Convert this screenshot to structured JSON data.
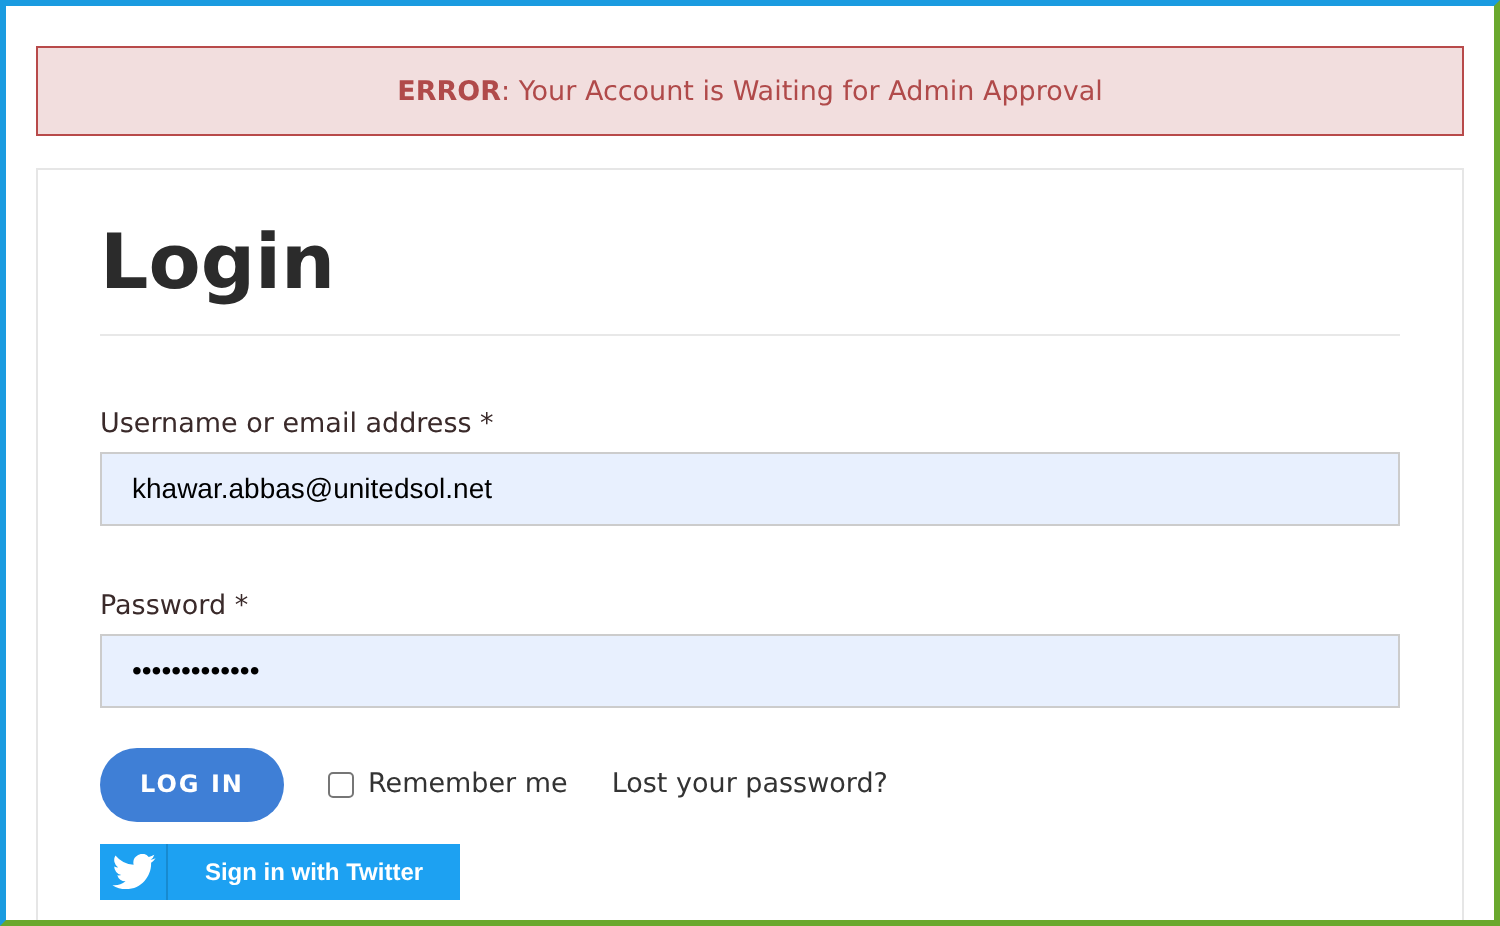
{
  "notice": {
    "kind": "error",
    "text": "**ERROR**: Your Account is Waiting for Admin Approval"
  },
  "title": "Login",
  "fields": [
    {
      "label": "Username or email address *",
      "value": "khawar.abbas@unitedsol.net"
    },
    {
      "label": "Password *",
      "value": "•••••••••••••"
    }
  ],
  "login_button": "LOG IN",
  "remember": {
    "label": "Remember me",
    "checked": false
  },
  "lost_password": "Lost your password?",
  "twitter_button": "Sign in with Twitter"
}
